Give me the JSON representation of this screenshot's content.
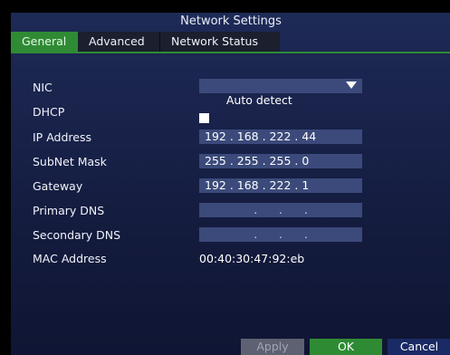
{
  "window": {
    "title": "Network Settings"
  },
  "tabs": [
    {
      "label": "General"
    },
    {
      "label": "Advanced"
    },
    {
      "label": "Network Status"
    }
  ],
  "fields": {
    "nic": {
      "label": "NIC",
      "value": "Auto detect"
    },
    "dhcp": {
      "label": "DHCP",
      "checked": true
    },
    "ip": {
      "label": "IP Address",
      "value": "192 . 168 . 222 . 44"
    },
    "subnet": {
      "label": "SubNet Mask",
      "value": "255 . 255 . 255 . 0"
    },
    "gateway": {
      "label": "Gateway",
      "value": "192 . 168 . 222 . 1"
    },
    "primary_dns": {
      "label": "Primary DNS",
      "value": ".      .      ."
    },
    "secondary_dns": {
      "label": "Secondary DNS",
      "value": ".      .      ."
    },
    "mac": {
      "label": "MAC Address",
      "value": "00:40:30:47:92:eb"
    }
  },
  "buttons": {
    "apply": "Apply",
    "ok": "OK",
    "cancel": "Cancel"
  },
  "colors": {
    "accent": "#2e8b34",
    "panel": "#1e2a57",
    "field": "#3b4a7a"
  }
}
